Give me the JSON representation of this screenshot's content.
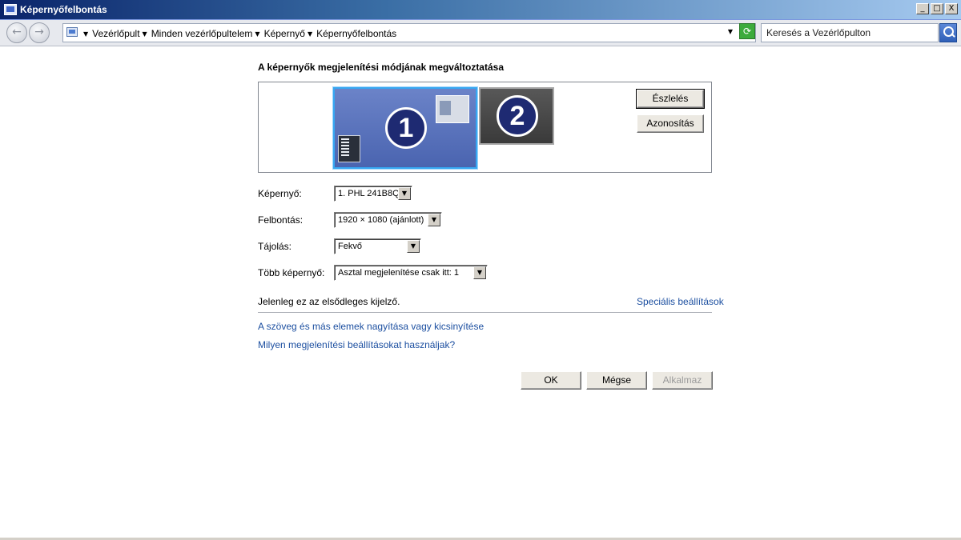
{
  "window": {
    "title": "Képernyőfelbontás",
    "controls": [
      "_",
      "□",
      "X"
    ]
  },
  "nav": {
    "back_icon": "arrow-left-icon",
    "forward_icon": "arrow-right-icon",
    "breadcrumbs": [
      "Vezérlőpult",
      "Minden vezérlőpultelem",
      "Képernyő",
      "Képernyőfelbontás"
    ],
    "search_placeholder": "Keresés a Vezérlőpulton"
  },
  "main": {
    "heading": "A képernyők megjelenítési módjának megváltoztatása",
    "monitors": [
      {
        "number": "1",
        "selected": true
      },
      {
        "number": "2",
        "selected": false
      }
    ],
    "detect_button": "Észlelés",
    "identify_button": "Azonosítás",
    "fields": {
      "display_label": "Képernyő:",
      "display_value": "1. PHL 241B8Q",
      "resolution_label": "Felbontás:",
      "resolution_value": "1920 × 1080 (ajánlott)",
      "orientation_label": "Tájolás:",
      "orientation_value": "Fekvő",
      "multiple_label": "Több képernyő:",
      "multiple_value": "Asztal megjelenítése csak itt: 1"
    },
    "primary_note": "Jelenleg ez az elsődleges kijelző.",
    "advanced_link": "Speciális beállítások",
    "link_scale": "A szöveg és más elemek nagyítása vagy kicsinyítése",
    "link_help": "Milyen megjelenítési beállításokat használjak?",
    "ok_button": "OK",
    "cancel_button": "Mégse",
    "apply_button": "Alkalmaz"
  },
  "colors": {
    "selected_monitor_border": "#37a7f2",
    "link": "#1c4fa0"
  }
}
